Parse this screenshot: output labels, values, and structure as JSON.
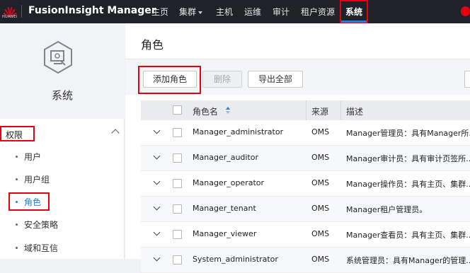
{
  "topbar": {
    "logo_text": "HUAWEI",
    "brand": "FusionInsight Manager",
    "nav": [
      {
        "label": "主页",
        "has_caret": false
      },
      {
        "label": "集群",
        "has_caret": true
      },
      {
        "label": "主机",
        "has_caret": false
      },
      {
        "label": "运维",
        "has_caret": false
      },
      {
        "label": "审计",
        "has_caret": false
      },
      {
        "label": "租户资源",
        "has_caret": false
      },
      {
        "label": "系统",
        "has_caret": false,
        "active": true
      }
    ]
  },
  "sidebar": {
    "section_title": "系统",
    "group_label": "权限",
    "items": [
      {
        "label": "用户"
      },
      {
        "label": "用户组"
      },
      {
        "label": "角色",
        "active": true
      },
      {
        "label": "安全策略"
      },
      {
        "label": "域和互信"
      }
    ]
  },
  "main": {
    "title": "角色",
    "buttons": {
      "add": "添加角色",
      "delete": "删除",
      "export": "导出全部"
    },
    "table": {
      "headers": [
        "角色名",
        "来源",
        "描述"
      ],
      "rows": [
        {
          "name": "Manager_administrator",
          "source": "OMS",
          "desc": "Manager管理员：具有Manager所..."
        },
        {
          "name": "Manager_auditor",
          "source": "OMS",
          "desc": "Manager审计员：具有审计页签所..."
        },
        {
          "name": "Manager_operator",
          "source": "OMS",
          "desc": "Manager操作员：具有主页、集群..."
        },
        {
          "name": "Manager_tenant",
          "source": "OMS",
          "desc": "Manager租户管理员。"
        },
        {
          "name": "Manager_viewer",
          "source": "OMS",
          "desc": "Manager查看员：具有主页、集群..."
        },
        {
          "name": "System_administrator",
          "source": "OMS",
          "desc": "系统管理员：具有Manager的管理..."
        }
      ]
    }
  },
  "colors": {
    "topbar_bg": "#1f2329",
    "accent_blue": "#2a7cd8",
    "highlight_red": "#e60012"
  }
}
